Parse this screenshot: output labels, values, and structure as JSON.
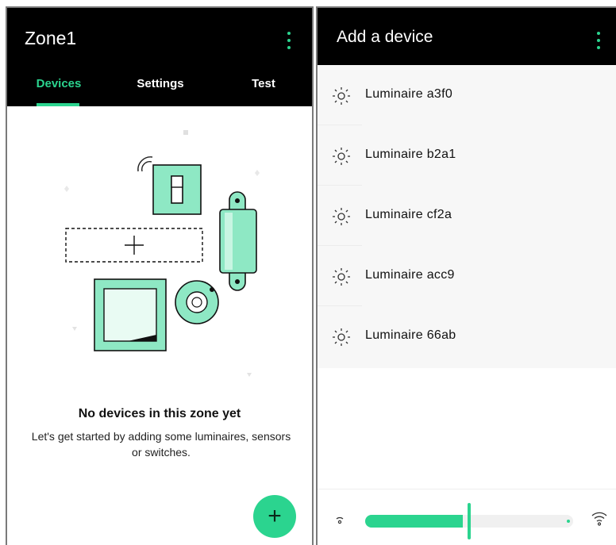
{
  "colors": {
    "accent": "#2bd48f",
    "header_bg": "#000000",
    "list_bg": "#f7f7f7",
    "illustration_fill": "#8ee8c4"
  },
  "zone_screen": {
    "title": "Zone1",
    "menu_icon": "more-vert-icon",
    "tabs": [
      {
        "label": "Devices",
        "active": true
      },
      {
        "label": "Settings",
        "active": false
      },
      {
        "label": "Test",
        "active": false
      }
    ],
    "empty_state": {
      "title": "No devices in this zone yet",
      "description": "Let's get started by adding some luminaires, sensors or switches."
    },
    "fab": {
      "icon": "plus-icon",
      "label": "+"
    }
  },
  "add_device_screen": {
    "title": "Add a device",
    "menu_icon": "more-vert-icon",
    "devices": [
      {
        "icon": "luminaire-icon",
        "name": "Luminaire a3f0"
      },
      {
        "icon": "luminaire-icon",
        "name": "Luminaire b2a1"
      },
      {
        "icon": "luminaire-icon",
        "name": "Luminaire cf2a"
      },
      {
        "icon": "luminaire-icon",
        "name": "Luminaire acc9"
      },
      {
        "icon": "luminaire-icon",
        "name": "Luminaire 66ab"
      }
    ],
    "signal_filter": {
      "min_icon": "wifi-low-icon",
      "max_icon": "wifi-high-icon",
      "level": 0.5
    }
  }
}
